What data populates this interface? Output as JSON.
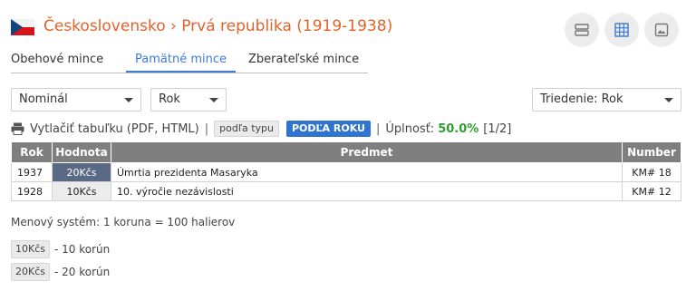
{
  "header": {
    "title": "Československo › Prvá republika (1919-1938)",
    "view_buttons": [
      "list-view-icon",
      "grid-view-icon",
      "image-view-icon"
    ]
  },
  "tabs": [
    {
      "label": "Obehové mince",
      "active": false
    },
    {
      "label": "Pamätné mince",
      "active": true
    },
    {
      "label": "Zberateľské mince",
      "active": false
    }
  ],
  "filters": {
    "nominal": "Nominál",
    "rok": "Rok",
    "sort": "Triedenie: Rok"
  },
  "toolbar": {
    "print_label": "Vytlačiť tabuľku (PDF, HTML)",
    "by_type": "podľa typu",
    "by_year": "PODĽA ROKU",
    "completeness_label": "Úplnosť:",
    "completeness_value": "50.0%",
    "count": "[1/2]"
  },
  "table": {
    "headers": [
      "Rok",
      "Hodnota",
      "Predmet",
      "Number"
    ],
    "rows": [
      {
        "rok": "1937",
        "hodnota": "20Kčs",
        "predmet": "Úmrtia prezidenta Masaryka",
        "number": "KM# 18",
        "owned": true
      },
      {
        "rok": "1928",
        "hodnota": "10Kčs",
        "predmet": "10. výročie nezávislosti",
        "number": "KM# 12",
        "owned": false
      }
    ]
  },
  "footer": {
    "menovy": "Menový systém: 1 koruna = 100 halierov",
    "denominations": [
      {
        "chip": "10Kčs",
        "text": "- 10 korún"
      },
      {
        "chip": "20Kčs",
        "text": "- 20 korún"
      }
    ]
  },
  "colors": {
    "title": "#e0632a",
    "active_tab": "#3d7bd4",
    "owned_cell": "#5a6a85",
    "header_bg": "#7f7f7f",
    "completeness": "#2f9e2f"
  }
}
